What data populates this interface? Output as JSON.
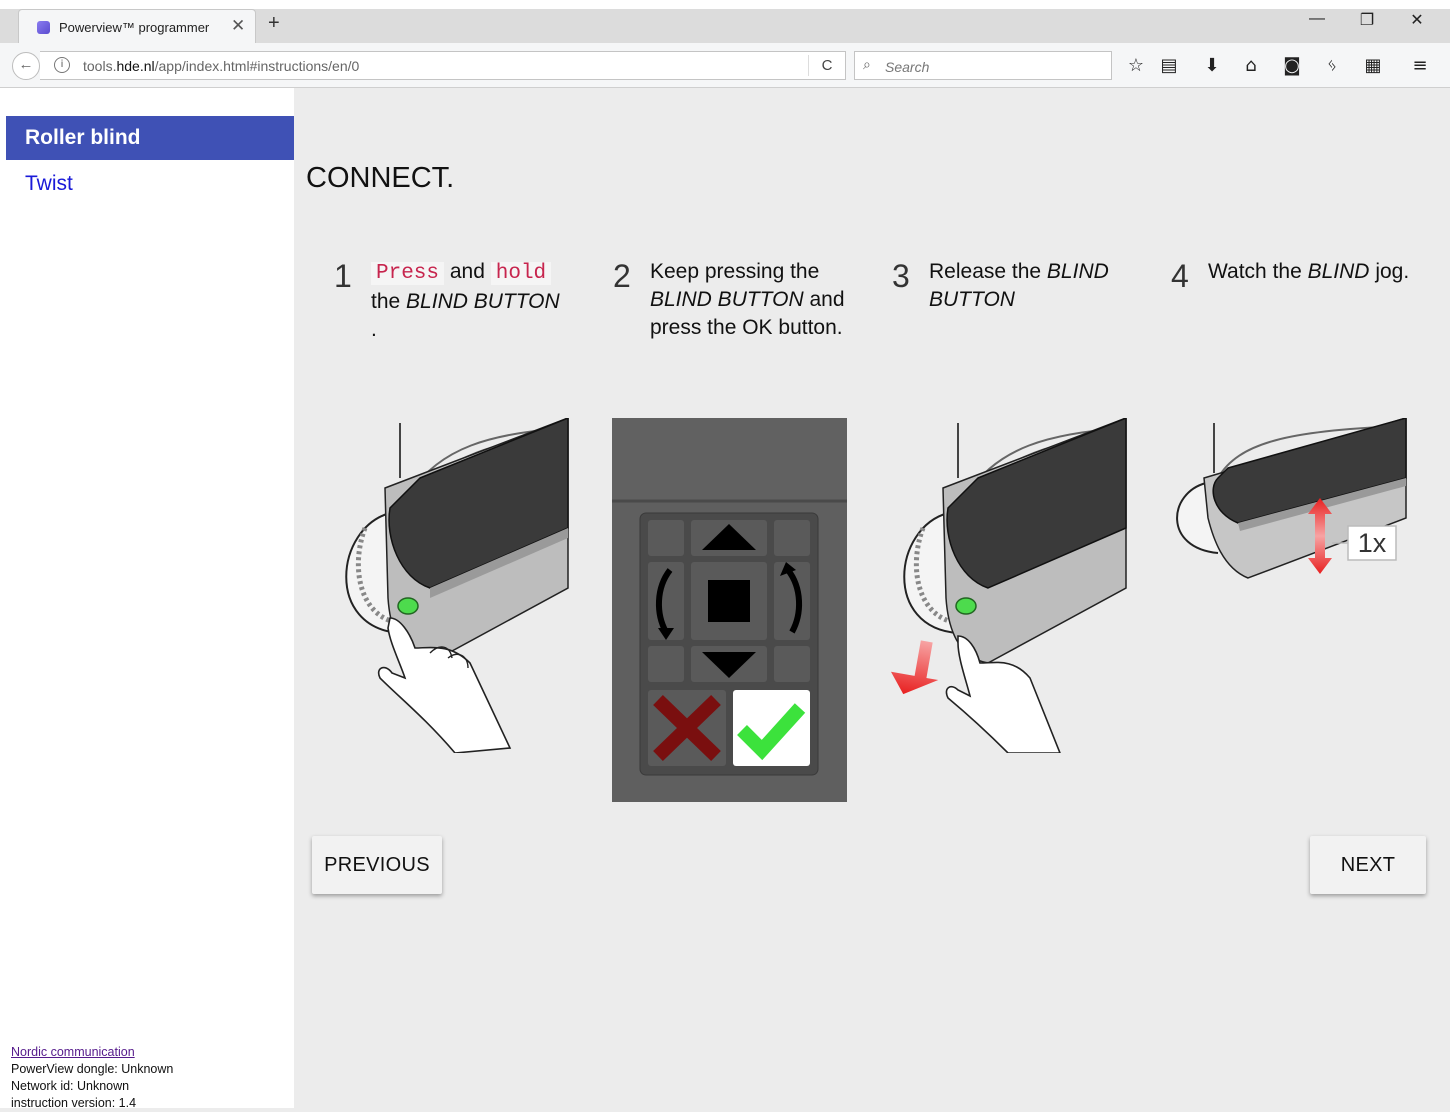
{
  "browser": {
    "tab_title": "Powerview™ programmer",
    "tab_close": "✕",
    "new_tab": "+",
    "win_minimize": "—",
    "win_restore": "❐",
    "win_close": "✕",
    "back": "←",
    "url_prefix": "tools.",
    "url_domain": "hde.nl",
    "url_path": "/app/index.html#instructions/en/0",
    "reload": "C",
    "search_placeholder": "Search",
    "toolbar_icons": [
      "star-icon",
      "reading-list-icon",
      "download-icon",
      "home-icon",
      "pocket-icon",
      "extension-icon",
      "qr-code-icon",
      "menu-icon"
    ]
  },
  "sidebar": {
    "items": [
      {
        "label": "Roller blind",
        "active": true
      },
      {
        "label": "Twist",
        "active": false
      }
    ],
    "status": {
      "link": "Nordic communication",
      "dongle": "PowerView dongle: Unknown",
      "network": "Network id: Unknown",
      "version": "instruction version: 1.4"
    }
  },
  "main": {
    "heading": "CONNECT.",
    "steps": [
      {
        "num": "1",
        "code1": "Press",
        "t1": "and",
        "code2": "hold",
        "t2": "the",
        "em": "BLIND BUTTON",
        "t3": "."
      },
      {
        "num": "2",
        "t1": "Keep pressing the",
        "em": "BLIND BUTTON",
        "t2": "and press the OK button."
      },
      {
        "num": "3",
        "t1": "Release the",
        "em": "BLIND BUTTON"
      },
      {
        "num": "4",
        "t1": "Watch the",
        "em": "BLIND",
        "t2": "jog."
      }
    ],
    "jog_label": "1x",
    "prev_label": "PREVIOUS",
    "next_label": "NEXT"
  },
  "colors": {
    "accent": "#3f51b5",
    "link": "#1a1ad8",
    "code": "#c7254e",
    "green": "#3ce23c",
    "red": "#7a0f0f"
  }
}
